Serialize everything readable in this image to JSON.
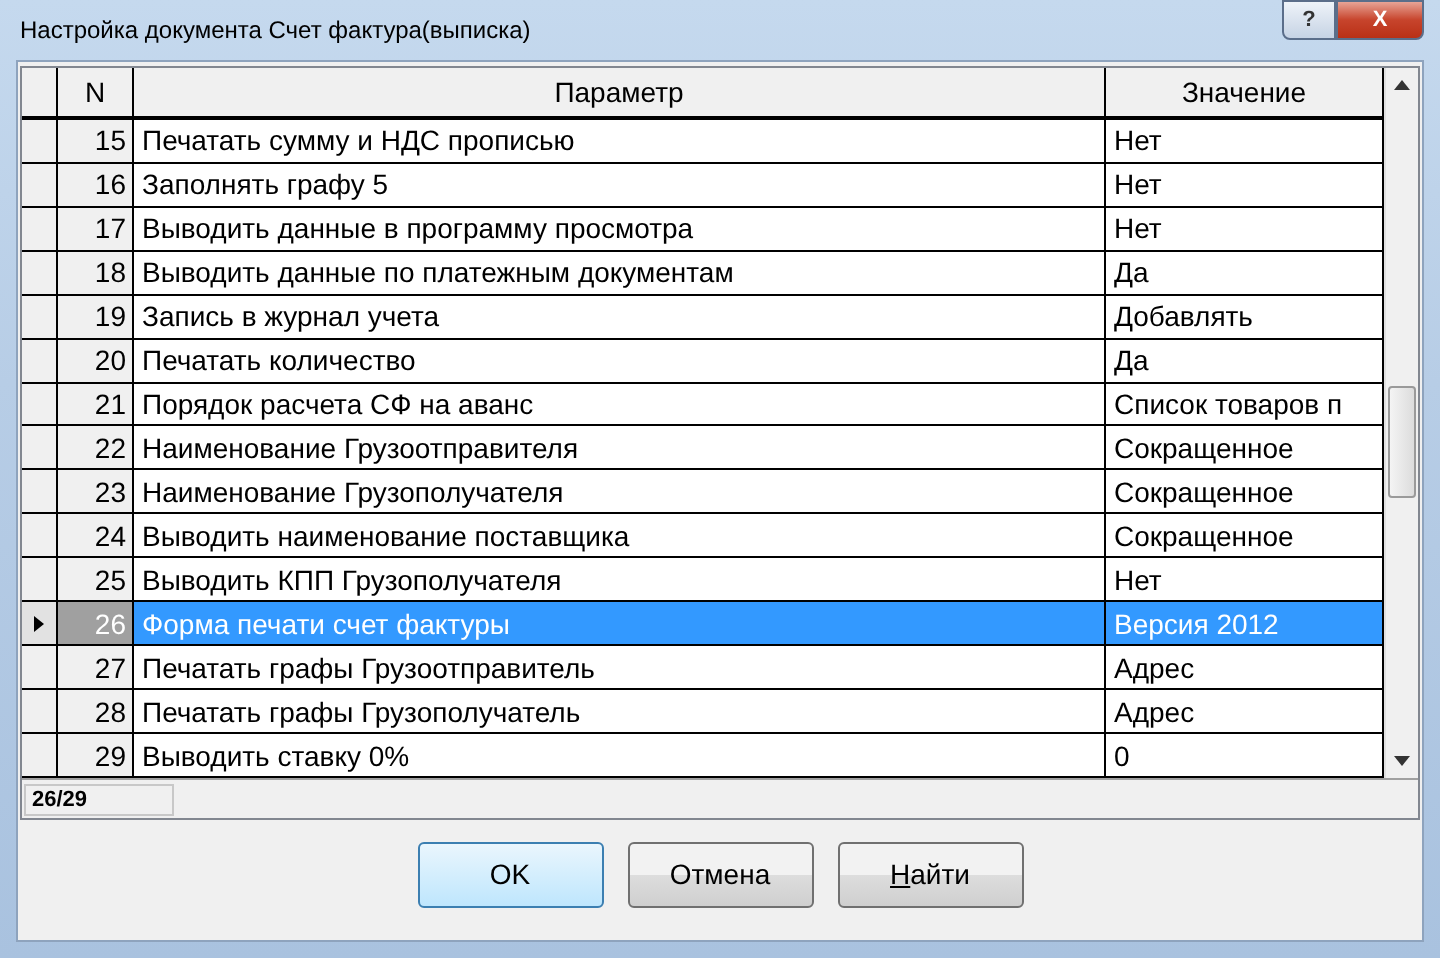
{
  "window": {
    "title": "Настройка документа Счет фактура(выписка)",
    "help_label": "?",
    "close_label": "X"
  },
  "table": {
    "columns": [
      "N",
      "Параметр",
      "Значение"
    ],
    "rows": [
      {
        "n": "15",
        "parameter": "Печатать сумму и НДС прописью",
        "value": "Нет",
        "selected": false
      },
      {
        "n": "16",
        "parameter": "Заполнять графу 5",
        "value": "Нет",
        "selected": false
      },
      {
        "n": "17",
        "parameter": "Выводить данные в программу просмотра",
        "value": "Нет",
        "selected": false
      },
      {
        "n": "18",
        "parameter": "Выводить данные по платежным документам",
        "value": "Да",
        "selected": false
      },
      {
        "n": "19",
        "parameter": "Запись в журнал учета",
        "value": "Добавлять",
        "selected": false
      },
      {
        "n": "20",
        "parameter": "Печатать количество",
        "value": "Да",
        "selected": false
      },
      {
        "n": "21",
        "parameter": "Порядок расчета СФ на аванс",
        "value": "Список товаров п",
        "selected": false
      },
      {
        "n": "22",
        "parameter": "Наименование Грузоотправителя",
        "value": "Сокращенное",
        "selected": false
      },
      {
        "n": "23",
        "parameter": "Наименование Грузополучателя",
        "value": "Сокращенное",
        "selected": false
      },
      {
        "n": "24",
        "parameter": "Выводить наименование поставщика",
        "value": "Сокращенное",
        "selected": false
      },
      {
        "n": "25",
        "parameter": "Выводить КПП Грузополучателя",
        "value": "Нет",
        "selected": false
      },
      {
        "n": "26",
        "parameter": "Форма печати счет фактуры",
        "value": "Версия 2012",
        "selected": true
      },
      {
        "n": "27",
        "parameter": "Печатать графы Грузоотправитель",
        "value": "Адрес",
        "selected": false
      },
      {
        "n": "28",
        "parameter": "Печатать графы Грузополучатель",
        "value": "Адрес",
        "selected": false
      },
      {
        "n": "29",
        "parameter": "Выводить ставку 0%",
        "value": "0",
        "selected": false
      }
    ]
  },
  "status_bar": {
    "position": "26/29"
  },
  "buttons": [
    {
      "label": "OK",
      "default": true,
      "underline_first": false
    },
    {
      "label": "Отмена",
      "default": false,
      "underline_first": false
    },
    {
      "label": "Найти",
      "default": false,
      "underline_first": true
    }
  ]
}
